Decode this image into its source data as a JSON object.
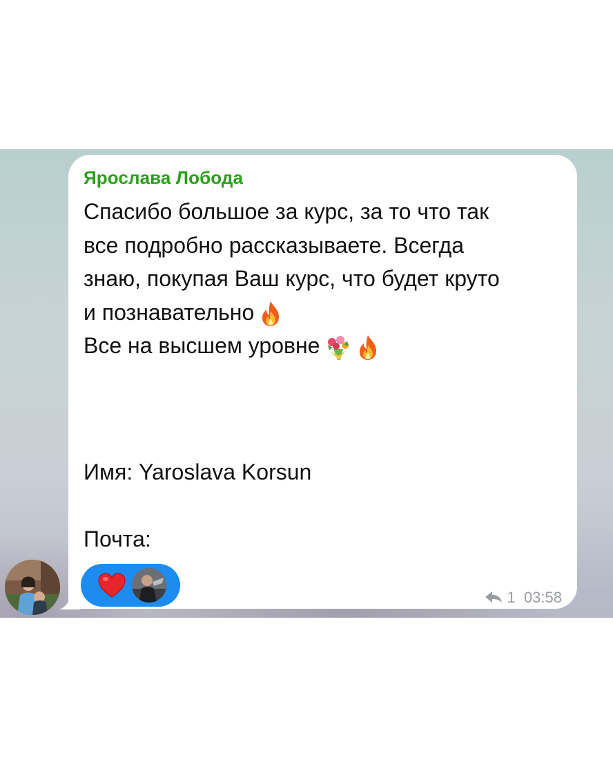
{
  "message": {
    "sender": "Ярослава Лобода",
    "lines": [
      "Спасибо большое за курс, за то что так",
      "все подробно рассказываете. Всегда",
      "знаю, покупая Ваш курс, что будет круто",
      "и познавательно",
      "Все на высшем уровне"
    ],
    "name_field": "Имя: Yaroslava Korsun",
    "email_label": "Почта:",
    "reply_count": "1",
    "time": "03:58"
  },
  "reactions": [
    {
      "icon": "heart-icon",
      "color": "#e6262b"
    },
    {
      "icon": "user-avatar"
    }
  ],
  "colors": {
    "sender_name": "#2aa01a",
    "reaction_pill": "#1c8cf0",
    "meta_text": "#9a9ea3",
    "bubble": "#ffffff"
  },
  "icons": {
    "fire": "fire-icon",
    "bouquet": "bouquet-icon",
    "reply": "reply-arrow-icon"
  }
}
